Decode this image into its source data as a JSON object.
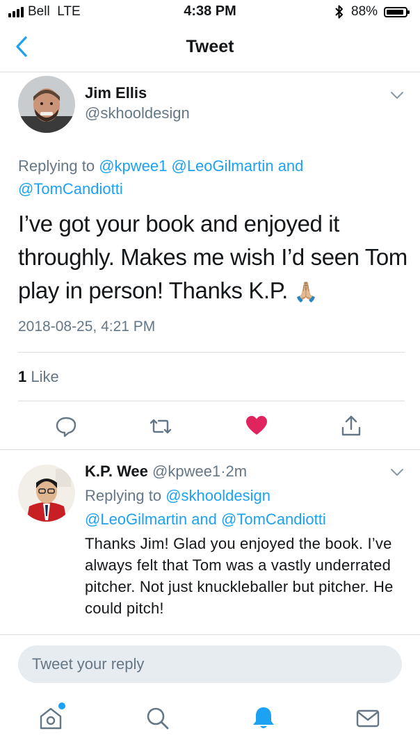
{
  "status_bar": {
    "carrier": "Bell",
    "network": "LTE",
    "time": "4:38 PM",
    "battery": "88%"
  },
  "nav": {
    "title": "Tweet"
  },
  "tweet": {
    "name": "Jim Ellis",
    "handle": "@skhooldesign",
    "replying_prefix": "Replying to",
    "replying_to": [
      "@kpwee1",
      "@LeoGilmartin",
      "@TomCandiotti"
    ],
    "replying_and": "and",
    "text": "I’ve got your book and enjoyed it throughly. Makes me wish I’d seen Tom play in person! Thanks K.P.",
    "emoji": "🙏🏼",
    "timestamp": "2018-08-25, 4:21 PM",
    "like_count": "1",
    "like_label": "Like",
    "liked": true
  },
  "reply": {
    "name": "K.P. Wee",
    "handle": "@kpwee1",
    "dot": "·",
    "age": "2m",
    "replying_prefix": "Replying to",
    "replying_to": [
      "@skhooldesign",
      "@LeoGilmartin",
      "@TomCandiotti"
    ],
    "replying_and": "and",
    "text": "Thanks Jim! Glad you enjoyed the book. I’ve always felt that Tom was a vastly underrated pitcher. Not just knuckleballer but pitcher. He could pitch!"
  },
  "composer": {
    "placeholder": "Tweet your reply"
  },
  "tab_bar": {
    "items": [
      {
        "icon": "home-icon",
        "badge": true
      },
      {
        "icon": "search-icon"
      },
      {
        "icon": "bell-icon",
        "active": true
      },
      {
        "icon": "mail-icon"
      }
    ]
  },
  "colors": {
    "accent": "#1da1f2",
    "like": "#e0245e",
    "muted": "#657786",
    "text": "#14171a"
  }
}
